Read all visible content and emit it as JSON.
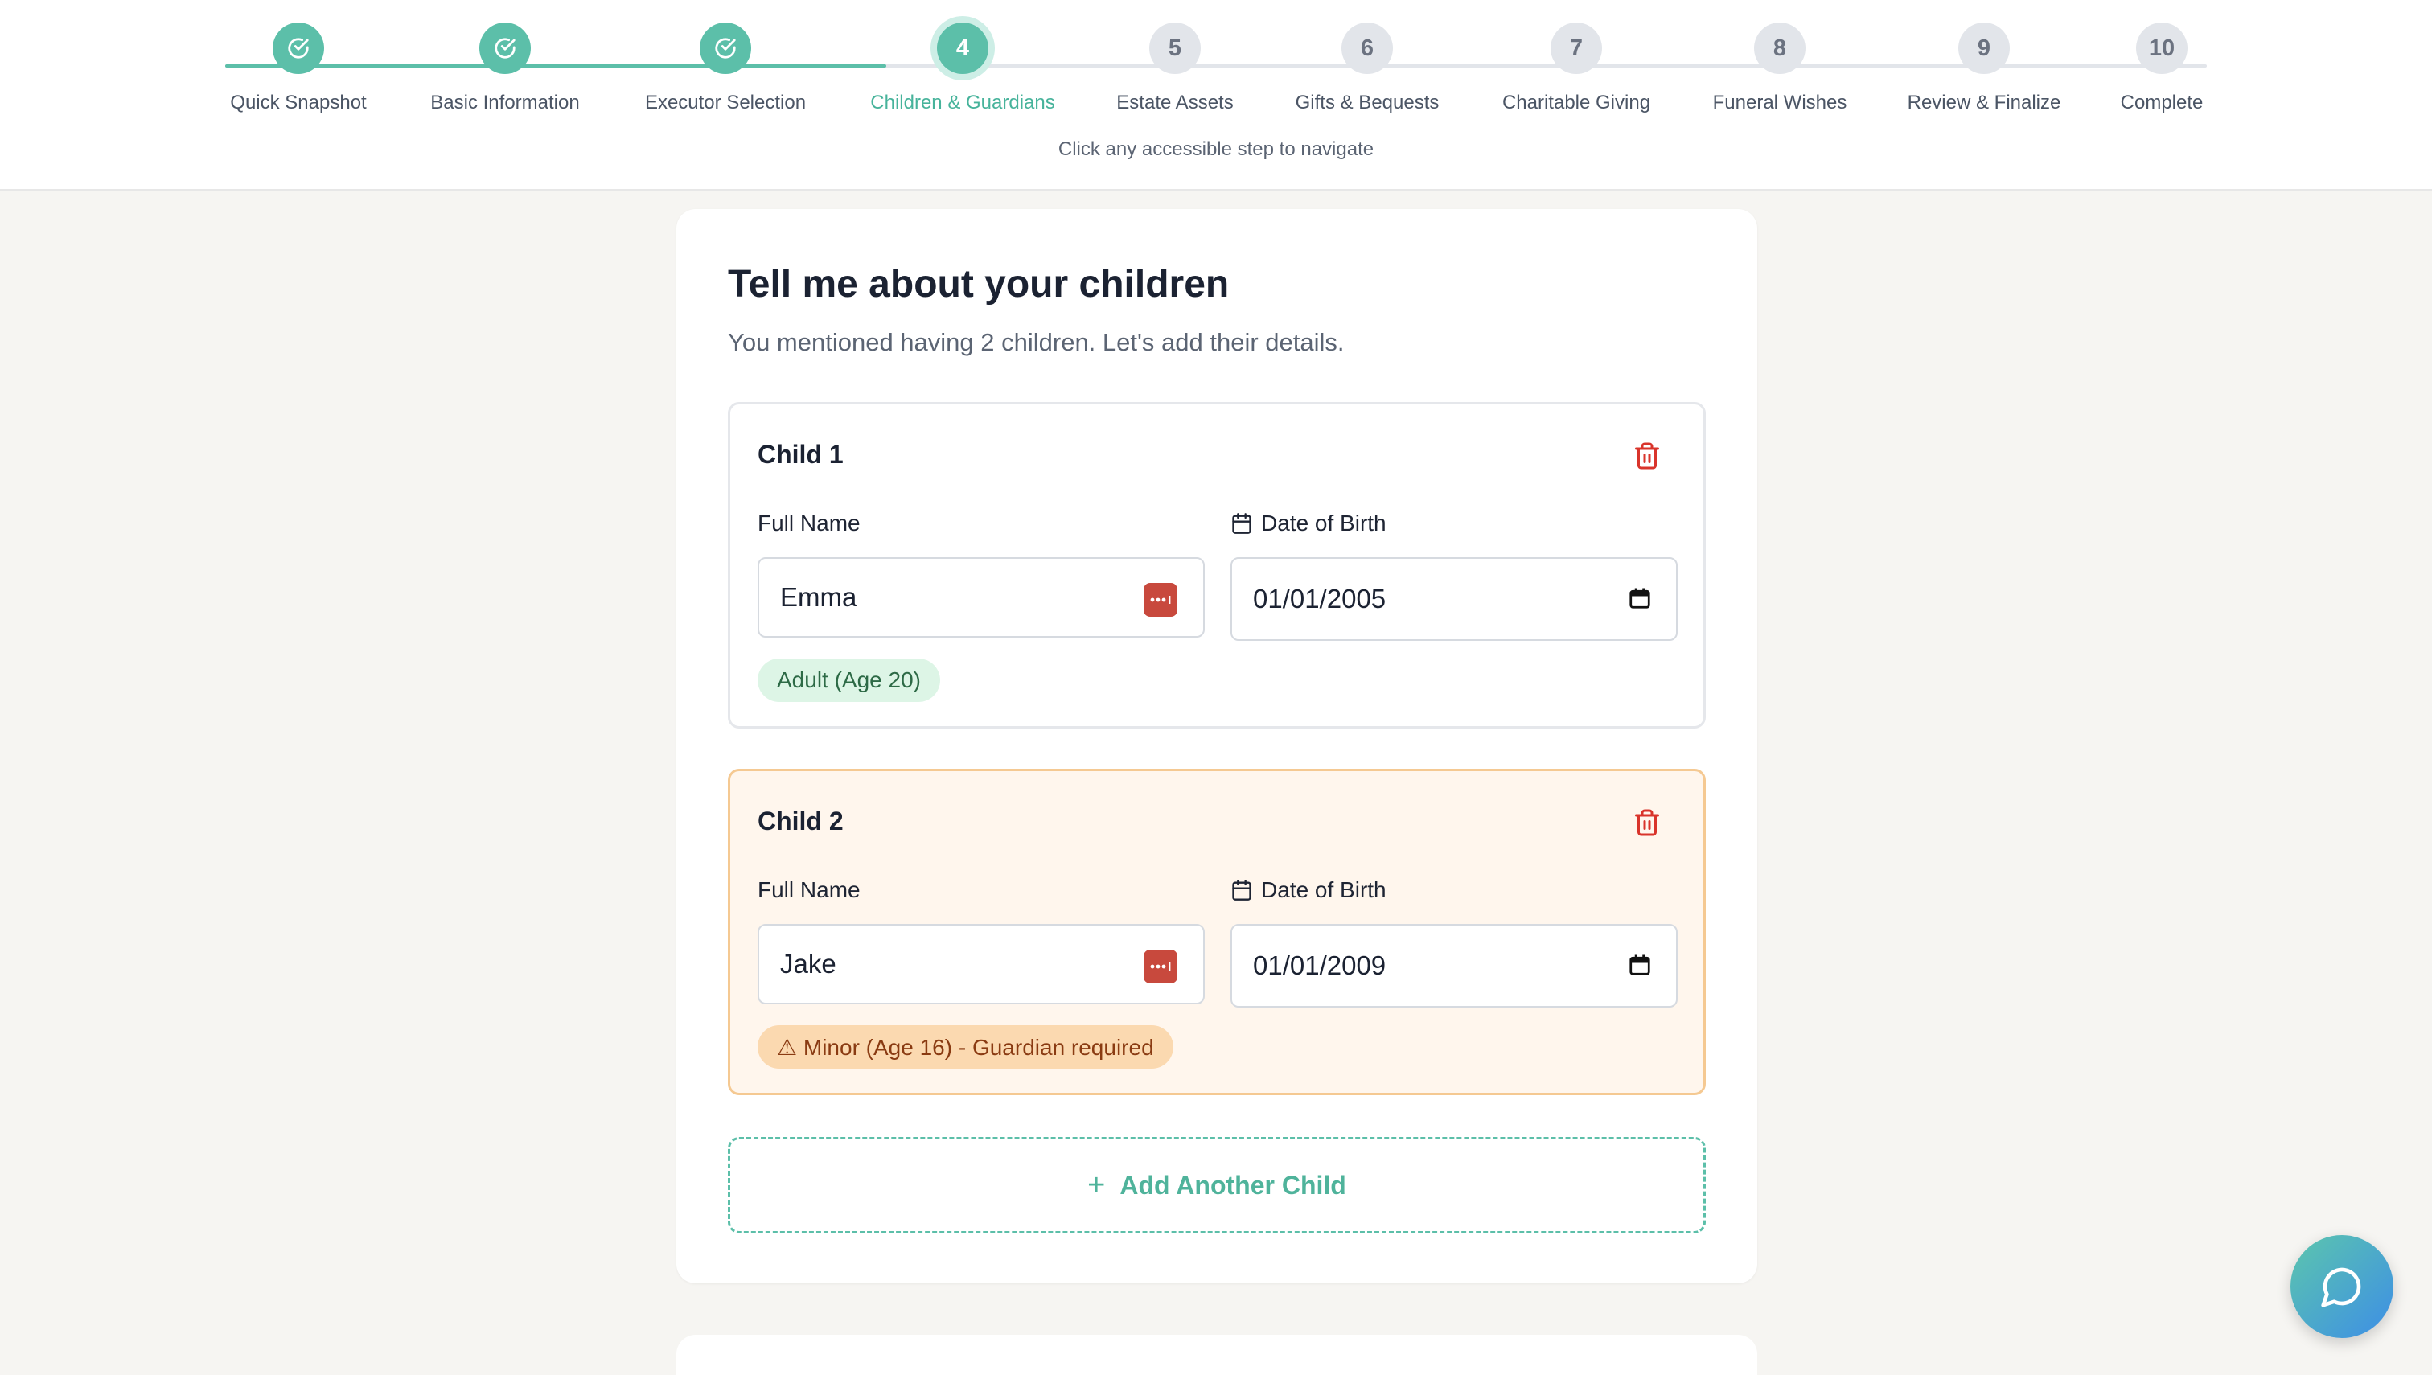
{
  "stepper": {
    "steps": [
      {
        "num": "1",
        "label": "Quick Snapshot",
        "state": "done"
      },
      {
        "num": "2",
        "label": "Basic Information",
        "state": "done"
      },
      {
        "num": "3",
        "label": "Executor Selection",
        "state": "done"
      },
      {
        "num": "4",
        "label": "Children & Guardians",
        "state": "active"
      },
      {
        "num": "5",
        "label": "Estate Assets",
        "state": "upcoming"
      },
      {
        "num": "6",
        "label": "Gifts & Bequests",
        "state": "upcoming"
      },
      {
        "num": "7",
        "label": "Charitable Giving",
        "state": "upcoming"
      },
      {
        "num": "8",
        "label": "Funeral Wishes",
        "state": "upcoming"
      },
      {
        "num": "9",
        "label": "Review & Finalize",
        "state": "upcoming"
      },
      {
        "num": "10",
        "label": "Complete",
        "state": "upcoming"
      }
    ],
    "hint": "Click any accessible step to navigate"
  },
  "main": {
    "title": "Tell me about your children",
    "subtitle": "You mentioned having 2 children. Let's add their details.",
    "children": [
      {
        "heading": "Child 1",
        "name_label": "Full Name",
        "name_value": "Emma",
        "dob_label": "Date of Birth",
        "dob_value": "01/01/2005",
        "badge": "Adult (Age 20)"
      },
      {
        "heading": "Child 2",
        "name_label": "Full Name",
        "name_value": "Jake",
        "dob_label": "Date of Birth",
        "dob_value": "01/01/2009",
        "badge": "⚠ Minor (Age 16) - Guardian required"
      }
    ],
    "add_label": "Add Another Child"
  },
  "colors": {
    "accent": "#5cbfa9",
    "danger": "#d9342b",
    "minor_border": "#f5c992",
    "minor_bg": "#fff6ed"
  },
  "icons": {
    "step_done": "check-circle-icon",
    "delete": "trash-icon",
    "date": "calendar-icon",
    "password_manager": "password-manager-icon",
    "chat": "chat-bubble-icon"
  }
}
